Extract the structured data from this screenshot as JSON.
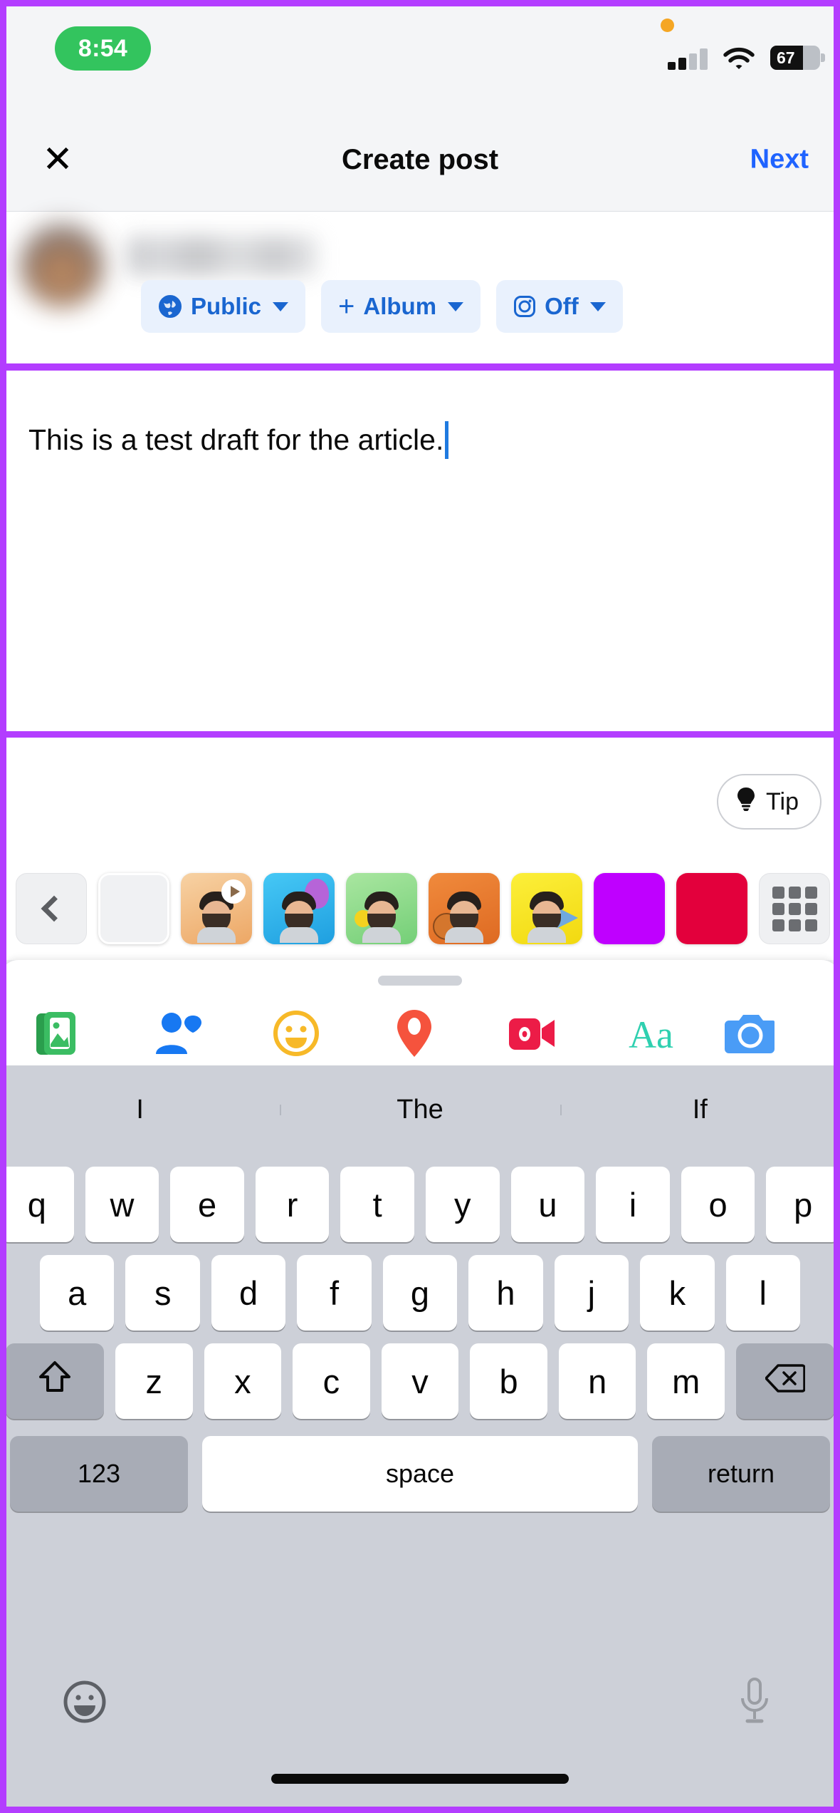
{
  "status_bar": {
    "time": "8:54",
    "battery_level": "67",
    "orange_dot_icon": "privacy-indicator-dot",
    "signal_icon": "cellular-signal-icon",
    "wifi_icon": "wifi-icon",
    "battery_icon": "battery-icon"
  },
  "header": {
    "close_icon": "✕",
    "title": "Create post",
    "next_label": "Next"
  },
  "composer_meta": {
    "avatar_alt": "blurred-profile-photo",
    "username_alt": "blurred-user-name",
    "chips": [
      {
        "icon": "globe-icon",
        "label": "Public",
        "caret": true
      },
      {
        "icon": "plus-icon",
        "label": "Album",
        "caret": true
      },
      {
        "icon": "instagram-icon",
        "label": "Off",
        "caret": true
      }
    ]
  },
  "composer": {
    "draft_text": "This is a test draft for the article.",
    "cursor_visible": true
  },
  "lower_panel": {
    "tip_label": "Tip",
    "tip_icon": "lightbulb-icon",
    "strip": {
      "back_icon": "chevron-left-icon",
      "grid_icon": "grid-icon",
      "items": [
        {
          "kind": "nav-back",
          "name": "sticker-strip-back"
        },
        {
          "kind": "blank",
          "name": "sticker-blank-tile"
        },
        {
          "kind": "avatar",
          "name": "avatar-sticker-video",
          "bg": "#f2c28a",
          "badge": "play"
        },
        {
          "kind": "avatar",
          "name": "avatar-sticker-balloon",
          "bg": "#29b6f6",
          "badge": "balloon"
        },
        {
          "kind": "avatar",
          "name": "avatar-sticker-flower",
          "bg": "#8fd98f",
          "badge": "flower"
        },
        {
          "kind": "avatar",
          "name": "avatar-sticker-basketball",
          "bg": "#e8772e",
          "badge": "ball"
        },
        {
          "kind": "avatar",
          "name": "avatar-sticker-megaphone",
          "bg": "#f7e61c",
          "badge": "megaphone"
        },
        {
          "kind": "color",
          "name": "color-swatch-purple",
          "bg": "#bf00ff"
        },
        {
          "kind": "color",
          "name": "color-swatch-red",
          "bg": "#e3003c"
        },
        {
          "kind": "grid",
          "name": "sticker-grid-button"
        }
      ]
    }
  },
  "toolbar": {
    "items": [
      {
        "name": "photo-video-icon",
        "color": "#2dab57"
      },
      {
        "name": "tag-people-icon",
        "color": "#1778f2"
      },
      {
        "name": "feeling-activity-icon",
        "color": "#f7b928"
      },
      {
        "name": "check-in-location-icon",
        "color": "#f5533d"
      },
      {
        "name": "live-video-icon",
        "color": "#ec1c47"
      },
      {
        "name": "text-style-icon",
        "color": "#2fd0b0",
        "label": "Aa"
      },
      {
        "name": "camera-icon",
        "color": "#4a9cf6"
      }
    ]
  },
  "keyboard": {
    "suggestions": [
      "I",
      "The",
      "If"
    ],
    "row1": [
      "q",
      "w",
      "e",
      "r",
      "t",
      "y",
      "u",
      "i",
      "o",
      "p"
    ],
    "row2": [
      "a",
      "s",
      "d",
      "f",
      "g",
      "h",
      "j",
      "k",
      "l"
    ],
    "row3": [
      "z",
      "x",
      "c",
      "v",
      "b",
      "n",
      "m"
    ],
    "shift_icon": "shift-arrow-icon",
    "backspace_icon": "backspace-icon",
    "numbers_label": "123",
    "space_label": "space",
    "return_label": "return",
    "emoji_icon": "emoji-keyboard-icon",
    "mic_icon": "microphone-icon"
  },
  "annotation": {
    "highlight_color": "#b33dff"
  }
}
